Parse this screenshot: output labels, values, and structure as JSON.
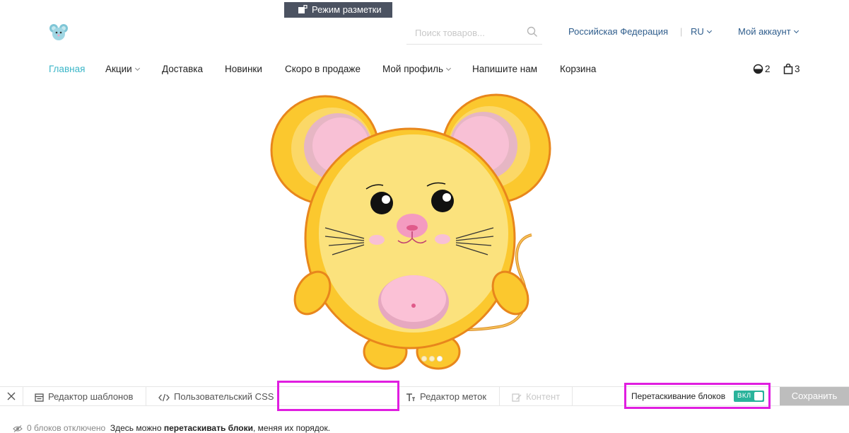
{
  "header": {
    "search": {
      "placeholder": "Поиск товаров...",
      "value": ""
    },
    "country": "Российская Федерация",
    "separator": "|",
    "language": "RU",
    "account": "Мой аккаунт"
  },
  "nav": {
    "items": [
      {
        "label": "Главная",
        "active": true
      },
      {
        "label": "Акции",
        "dropdown": true
      },
      {
        "label": "Доставка"
      },
      {
        "label": "Новинки"
      },
      {
        "label": "Скоро в продаже"
      },
      {
        "label": "Мой профиль",
        "dropdown": true
      },
      {
        "label": "Напишите нам"
      },
      {
        "label": "Корзина"
      }
    ],
    "compare_count": "2",
    "cart_count": "3"
  },
  "hero": {
    "image": "mouse-illustration",
    "slides": 3,
    "active_slide": 3
  },
  "toolbar": {
    "template_editor": "Редактор шаблонов",
    "custom_css": "Пользовательский CSS",
    "markup_mode": "Режим разметки",
    "label_editor": "Редактор меток",
    "content": "Контент",
    "drag_blocks": "Перетаскивание блоков",
    "toggle_on": "ВКЛ",
    "save": "Сохранить"
  },
  "status": {
    "disabled_count": "0 блоков отключено",
    "hint_before": "Здесь можно ",
    "hint_bold": "перетаскивать блоки",
    "hint_after": ", меняя их порядок."
  },
  "colors": {
    "accent": "#3bb6c8",
    "link": "#2f5d8c",
    "toolbar_active": "#4b5261",
    "highlight": "#e01ee0",
    "toggle": "#2ab39b",
    "save_disabled": "#bdbdbd"
  }
}
